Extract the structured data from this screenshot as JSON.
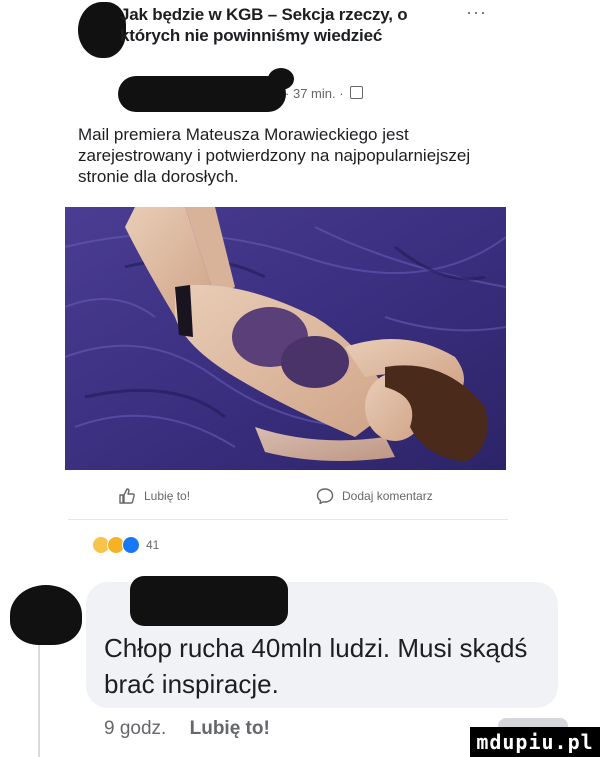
{
  "post": {
    "group_title": "Jak będzie w KGB – Sekcja rzeczy, o których nie powinniśmy wiedzieć",
    "more_label": "···",
    "timestamp": "37 min.",
    "meta_separator": "·",
    "text": "Mail premiera Mateusza Morawieckiego jest zarejestrowany i potwierdzony na najpopularniejszej stronie dla dorosłych.",
    "actions": {
      "like_label": "Lubię to!",
      "comment_label": "Dodaj komentarz"
    },
    "reactions": {
      "count": "41",
      "types": [
        "haha-icon",
        "wow-icon",
        "like-icon"
      ]
    }
  },
  "comment": {
    "text": "Chłop rucha 40mln ludzi. Musi skądś brać inspiracje.",
    "time": "9 godz.",
    "like_label": "Lubię to!"
  },
  "watermark": "mdupiu.pl",
  "colors": {
    "text": "#1c1e21",
    "secondary": "#65676b",
    "bubble": "#f0f2f5",
    "like_blue": "#1877f2"
  }
}
